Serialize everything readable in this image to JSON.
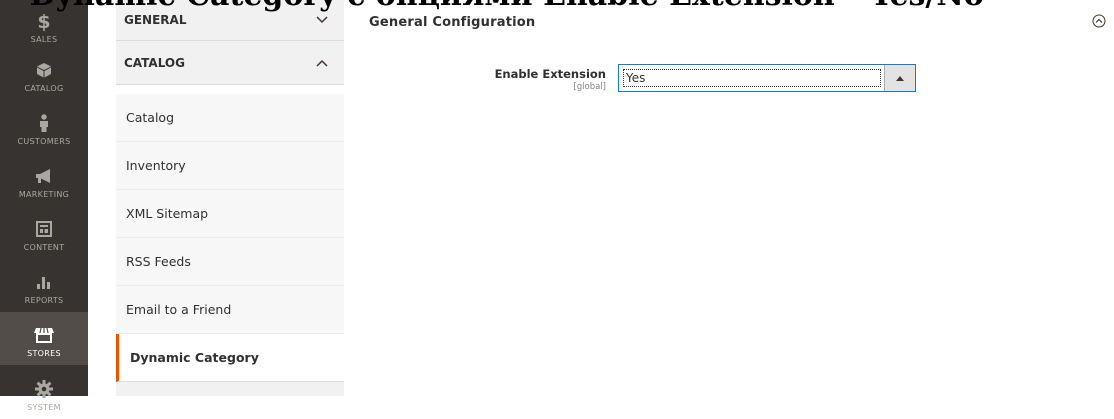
{
  "overlay_title": "• Dynamic Category с опциями Enable Extension – Yes/No",
  "sidebar": {
    "items": [
      {
        "label": "SALES",
        "icon": "dollar-icon"
      },
      {
        "label": "CATALOG",
        "icon": "cube-icon"
      },
      {
        "label": "CUSTOMERS",
        "icon": "person-icon"
      },
      {
        "label": "MARKETING",
        "icon": "megaphone-icon"
      },
      {
        "label": "CONTENT",
        "icon": "layout-icon"
      },
      {
        "label": "REPORTS",
        "icon": "bar-chart-icon"
      },
      {
        "label": "STORES",
        "icon": "store-icon"
      },
      {
        "label": "SYSTEM",
        "icon": "gear-icon"
      }
    ],
    "active": "STORES"
  },
  "config_nav": {
    "sections": [
      {
        "label": "GENERAL",
        "state": "collapsed"
      },
      {
        "label": "CATALOG",
        "state": "expanded"
      }
    ],
    "links": [
      {
        "label": "Catalog"
      },
      {
        "label": "Inventory"
      },
      {
        "label": "XML Sitemap"
      },
      {
        "label": "RSS Feeds"
      },
      {
        "label": "Email to a Friend"
      },
      {
        "label": "Dynamic Category"
      }
    ],
    "active_link": "Dynamic Category"
  },
  "main": {
    "section_title": "General Configuration",
    "fields": [
      {
        "label": "Enable Extension",
        "scope": "[global]",
        "value": "Yes"
      }
    ]
  },
  "colors": {
    "accent": "#eb5202",
    "select_border": "#1979c3",
    "rail_bg": "#373330"
  }
}
